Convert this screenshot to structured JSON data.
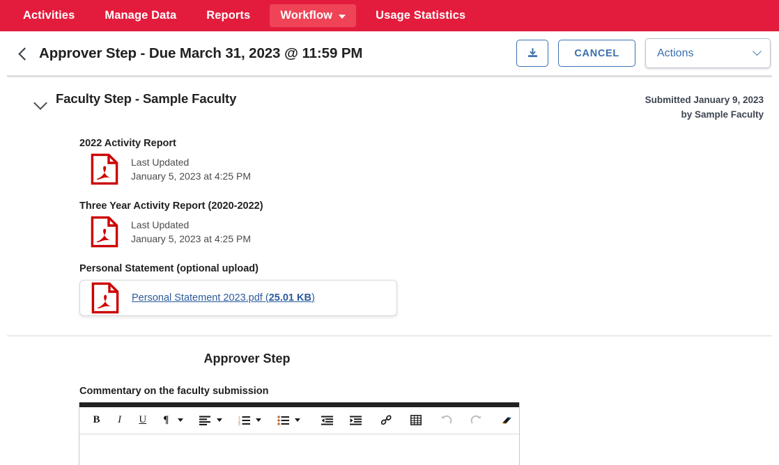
{
  "nav": {
    "items": [
      {
        "label": "Activities",
        "active": false,
        "has_caret": false
      },
      {
        "label": "Manage Data",
        "active": false,
        "has_caret": false
      },
      {
        "label": "Reports",
        "active": false,
        "has_caret": false
      },
      {
        "label": "Workflow",
        "active": true,
        "has_caret": true
      },
      {
        "label": "Usage Statistics",
        "active": false,
        "has_caret": false
      }
    ]
  },
  "header": {
    "back_icon": "chevron-left-icon",
    "title": "Approver Step - Due March 31, 2023 @ 11:59 PM",
    "download_icon": "download-icon",
    "cancel_label": "CANCEL",
    "actions_label": "Actions",
    "actions_caret_icon": "chevron-down-icon"
  },
  "section": {
    "collapse_icon": "chevron-down-icon",
    "title": "Faculty Step - Sample Faculty",
    "submitted_date": "Submitted January 9, 2023",
    "submitted_by": "by Sample Faculty"
  },
  "documents": [
    {
      "label": "2022 Activity Report",
      "icon": "pdf-file-icon",
      "meta_line1": "Last Updated",
      "meta_line2": "January 5, 2023 at 4:25 PM"
    },
    {
      "label": "Three Year Activity Report (2020-2022)",
      "icon": "pdf-file-icon",
      "meta_line1": "Last Updated",
      "meta_line2": "January 5, 2023 at 4:25 PM"
    }
  ],
  "upload": {
    "label": "Personal Statement (optional upload)",
    "icon": "pdf-file-icon",
    "file_name": "Personal Statement 2023.pdf (",
    "file_size": "25.01 KB",
    "file_suffix": ")"
  },
  "approver": {
    "title": "Approver Step",
    "commentary_label": "Commentary on the faculty submission",
    "commentary_value": ""
  },
  "toolbar": {
    "bold": "B",
    "italic": "I",
    "underline": "U",
    "paragraph": "¶",
    "align": "align-left-icon",
    "numbered_list": "numbered-list-icon",
    "bullet_list": "bullet-list-icon",
    "outdent": "outdent-icon",
    "indent": "indent-icon",
    "link": "link-icon",
    "table": "table-icon",
    "undo": "undo-icon",
    "redo": "redo-icon",
    "clear_format": "eraser-icon"
  },
  "colors": {
    "nav_red": "#e31c3d",
    "nav_active_red": "#ef4457",
    "link_blue": "#2b5a9b",
    "button_blue": "#3a6fae",
    "pdf_red": "#cc0000"
  }
}
